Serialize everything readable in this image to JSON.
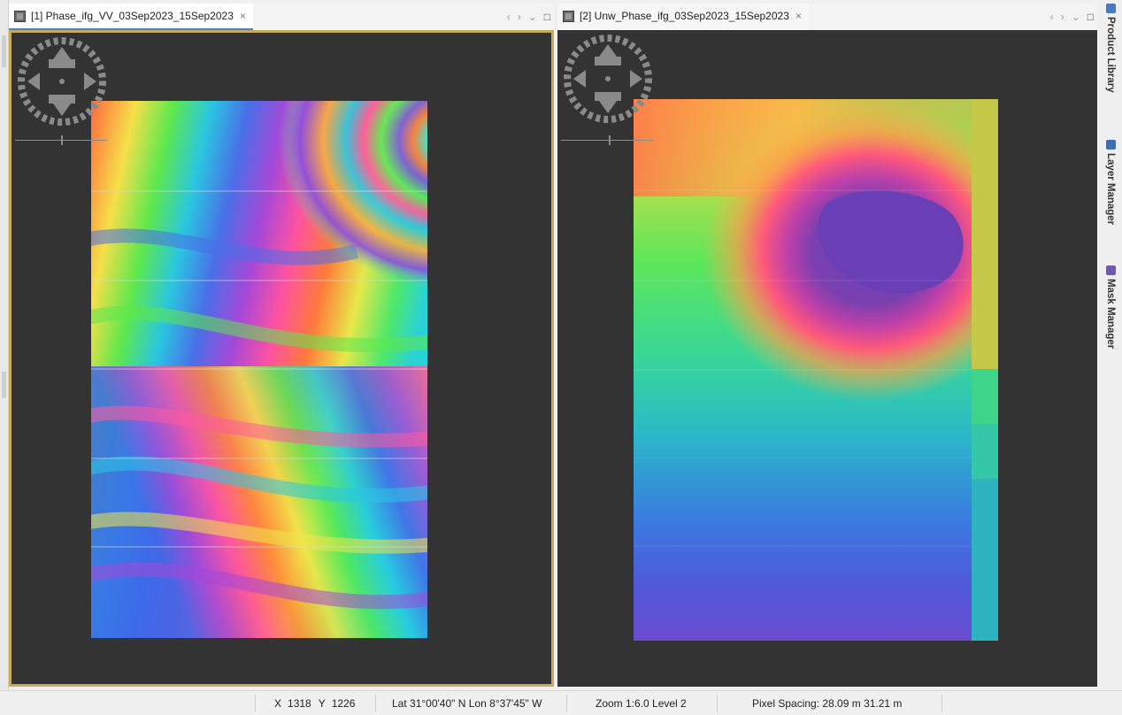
{
  "left_view": {
    "tab_title": "[1] Phase_ifg_VV_03Sep2023_15Sep2023",
    "close_glyph": "×"
  },
  "right_view": {
    "tab_title": "[2] Unw_Phase_ifg_03Sep2023_15Sep2023",
    "close_glyph": "×"
  },
  "tab_controls": {
    "prev": "‹",
    "next": "›",
    "menu": "⌄",
    "maximize": "□"
  },
  "icons": {
    "tab_doc": "raster-document-icon",
    "nav_pan": "pan-navigation-icon",
    "zoom_slider": "zoom-slider-icon",
    "product_library": "product-library-icon",
    "layer_manager": "layer-manager-icon",
    "mask_manager": "mask-manager-icon"
  },
  "side_dock": {
    "items": [
      {
        "label": "Product Library",
        "color": "#4a7ab8"
      },
      {
        "label": "Layer Manager",
        "color": "#3d6fb0"
      },
      {
        "label": "Mask Manager",
        "color": "#6f5aa8"
      }
    ]
  },
  "status_bar": {
    "pixel_x_label": "X",
    "pixel_x": "1318",
    "pixel_y_label": "Y",
    "pixel_y": "1226",
    "geo": "Lat 31°00'40\" N  Lon 8°37'45\" W",
    "zoom": "Zoom 1:6.0  Level 2",
    "pixel_spacing": "Pixel Spacing: 28.09 m  31.21 m"
  },
  "colors": {
    "viewport_bg": "#333333",
    "selected_view_border": "#c9a95a",
    "active_tab_underline": "#4d7fc4"
  }
}
